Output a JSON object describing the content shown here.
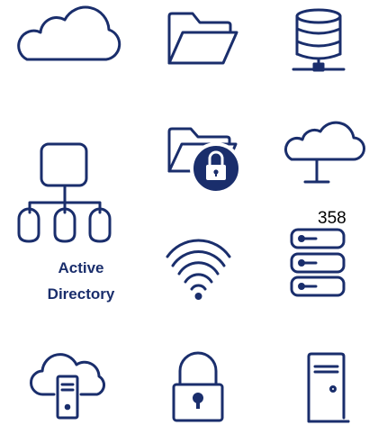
{
  "colors": {
    "icon": "#1a2e6c"
  },
  "icons": [
    "cloud-icon",
    "folder-icon",
    "database-server-icon",
    "locked-folder-icon",
    "cloud-network-icon",
    "active-directory-icon",
    "wifi-icon",
    "server-rack-icon",
    "cloud-server-icon",
    "padlock-icon",
    "tower-server-icon"
  ],
  "active_directory": {
    "line1": "Active",
    "line2": "Directory"
  },
  "badge_number": "358"
}
